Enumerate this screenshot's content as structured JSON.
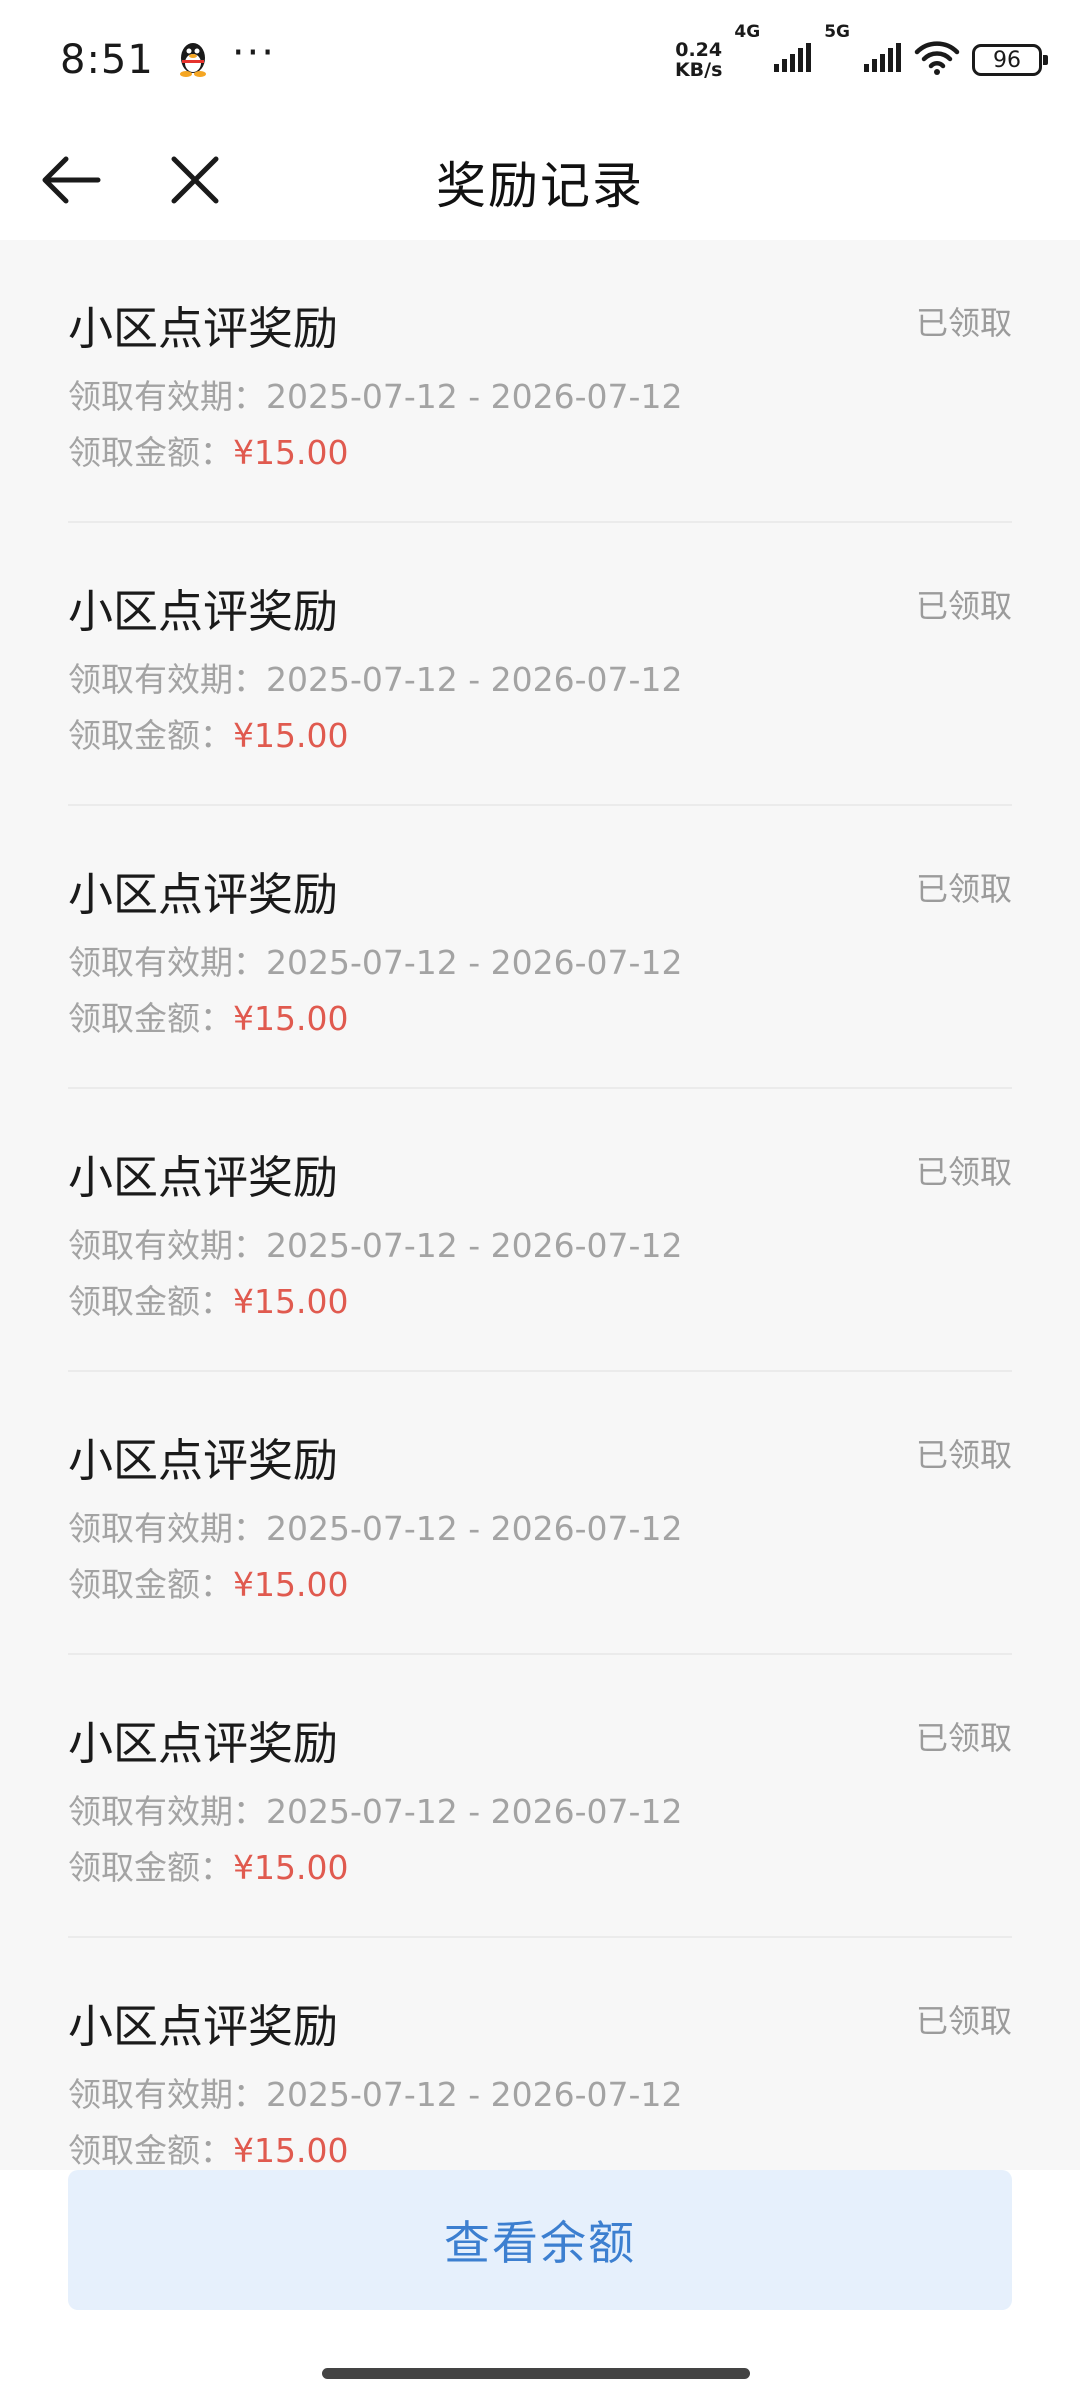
{
  "status_bar": {
    "time": "8:51",
    "notification_icon": "qq-penguin-icon",
    "more": "···",
    "speed_value": "0.24",
    "speed_unit": "KB/s",
    "net_4g": "4G",
    "net_5g": "5G",
    "battery": "96"
  },
  "nav": {
    "title": "奖励记录",
    "back_icon": "arrow-left-icon",
    "close_icon": "close-icon"
  },
  "colors": {
    "amount": "#e05a4f",
    "button_bg": "#e6f0fc",
    "button_text": "#3c7fd0",
    "status": "#9b9b9b"
  },
  "records": [
    {
      "title": "小区点评奖励",
      "status": "已领取",
      "validity_label": "领取有效期：",
      "validity": "2025-07-12 - 2026-07-12",
      "amount_label": "领取金额：",
      "amount": "¥15.00"
    },
    {
      "title": "小区点评奖励",
      "status": "已领取",
      "validity_label": "领取有效期：",
      "validity": "2025-07-12 - 2026-07-12",
      "amount_label": "领取金额：",
      "amount": "¥15.00"
    },
    {
      "title": "小区点评奖励",
      "status": "已领取",
      "validity_label": "领取有效期：",
      "validity": "2025-07-12 - 2026-07-12",
      "amount_label": "领取金额：",
      "amount": "¥15.00"
    },
    {
      "title": "小区点评奖励",
      "status": "已领取",
      "validity_label": "领取有效期：",
      "validity": "2025-07-12 - 2026-07-12",
      "amount_label": "领取金额：",
      "amount": "¥15.00"
    },
    {
      "title": "小区点评奖励",
      "status": "已领取",
      "validity_label": "领取有效期：",
      "validity": "2025-07-12 - 2026-07-12",
      "amount_label": "领取金额：",
      "amount": "¥15.00"
    },
    {
      "title": "小区点评奖励",
      "status": "已领取",
      "validity_label": "领取有效期：",
      "validity": "2025-07-12 - 2026-07-12",
      "amount_label": "领取金额：",
      "amount": "¥15.00"
    },
    {
      "title": "小区点评奖励",
      "status": "已领取",
      "validity_label": "领取有效期：",
      "validity": "2025-07-12 - 2026-07-12",
      "amount_label": "领取金额：",
      "amount": "¥15.00"
    }
  ],
  "footer": {
    "balance_button": "查看余额"
  }
}
